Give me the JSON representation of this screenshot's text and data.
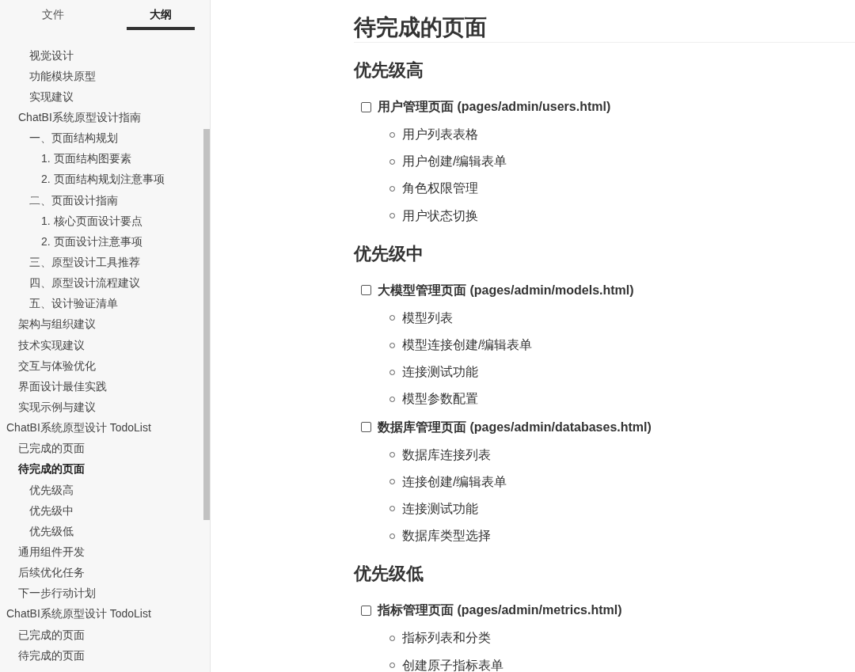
{
  "sidebar": {
    "tabs": [
      {
        "label": "文件",
        "selected": false
      },
      {
        "label": "大纲",
        "selected": true
      }
    ],
    "outline": [
      {
        "children": [
          {
            "children": [
              {
                "label": "视觉设计",
                "selected": false
              },
              {
                "label": "功能模块原型",
                "selected": false
              },
              {
                "label": "实现建议",
                "selected": false
              }
            ]
          },
          {
            "label": "ChatBI系统原型设计指南",
            "selected": false,
            "children": [
              {
                "label": "一、页面结构规划",
                "selected": false,
                "children": [
                  {
                    "label": "1. 页面结构图要素",
                    "selected": false
                  },
                  {
                    "label": "2. 页面结构规划注意事项",
                    "selected": false
                  }
                ]
              },
              {
                "label": "二、页面设计指南",
                "selected": false,
                "children": [
                  {
                    "label": "1. 核心页面设计要点",
                    "selected": false
                  },
                  {
                    "label": "2. 页面设计注意事项",
                    "selected": false
                  }
                ]
              },
              {
                "label": "三、原型设计工具推荐",
                "selected": false
              },
              {
                "label": "四、原型设计流程建议",
                "selected": false
              },
              {
                "label": "五、设计验证清单",
                "selected": false
              }
            ]
          },
          {
            "label": "架构与组织建议",
            "selected": false
          },
          {
            "label": "技术实现建议",
            "selected": false
          },
          {
            "label": "交互与体验优化",
            "selected": false
          },
          {
            "label": "界面设计最佳实践",
            "selected": false
          },
          {
            "label": "实现示例与建议",
            "selected": false
          }
        ]
      },
      {
        "label": "ChatBI系统原型设计 TodoList",
        "selected": false,
        "children": [
          {
            "label": "已完成的页面",
            "selected": false
          },
          {
            "label": "待完成的页面",
            "selected": true,
            "children": [
              {
                "label": "优先级高",
                "selected": false
              },
              {
                "label": "优先级中",
                "selected": false
              },
              {
                "label": "优先级低",
                "selected": false
              }
            ]
          },
          {
            "label": "通用组件开发",
            "selected": false
          },
          {
            "label": "后续优化任务",
            "selected": false
          },
          {
            "label": "下一步行动计划",
            "selected": false
          }
        ]
      },
      {
        "label": "ChatBI系统原型设计 TodoList",
        "selected": false,
        "children": [
          {
            "label": "已完成的页面",
            "selected": false
          },
          {
            "label": "待完成的页面",
            "selected": false
          }
        ]
      }
    ]
  },
  "document": {
    "title": "待完成的页面",
    "sections": [
      {
        "heading": "优先级高",
        "tasks": [
          {
            "label": "用户管理页面 (pages/admin/users.html)",
            "checked": false,
            "items": [
              "用户列表表格",
              "用户创建/编辑表单",
              "角色权限管理",
              "用户状态切换"
            ]
          }
        ]
      },
      {
        "heading": "优先级中",
        "tasks": [
          {
            "label": "大模型管理页面 (pages/admin/models.html)",
            "checked": false,
            "items": [
              "模型列表",
              "模型连接创建/编辑表单",
              "连接测试功能",
              "模型参数配置"
            ]
          },
          {
            "label": "数据库管理页面 (pages/admin/databases.html)",
            "checked": false,
            "items": [
              "数据库连接列表",
              "连接创建/编辑表单",
              "连接测试功能",
              "数据库类型选择"
            ]
          }
        ]
      },
      {
        "heading": "优先级低",
        "tasks": [
          {
            "label": "指标管理页面 (pages/admin/metrics.html)",
            "checked": false,
            "items": [
              "指标列表和分类",
              "创建原子指标表单"
            ]
          }
        ]
      }
    ]
  }
}
